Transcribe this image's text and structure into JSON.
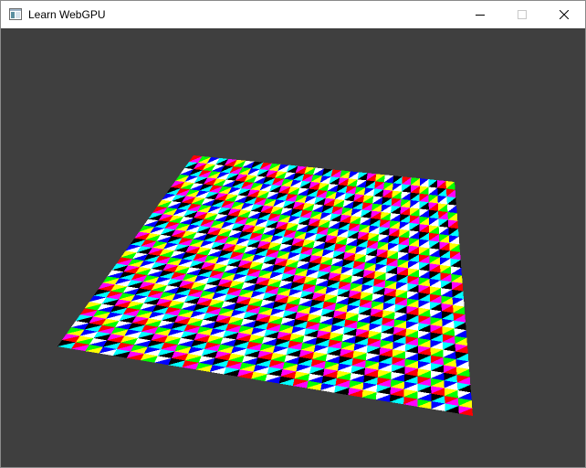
{
  "window": {
    "title": "Learn WebGPU",
    "icon": "app-window-icon",
    "controls": {
      "minimize_icon": "minimize-icon",
      "maximize_icon": "maximize-icon",
      "close_icon": "close-icon"
    }
  },
  "viewport": {
    "clear_color": "#3f3f3f",
    "scene": "perspective-plane-with-vertex-colored-triangle-grid",
    "vertex_palette": [
      "#ff0000",
      "#00ff00",
      "#0000ff",
      "#00ffff",
      "#ff00ff",
      "#ffff00",
      "#ffffff",
      "#000000"
    ]
  }
}
